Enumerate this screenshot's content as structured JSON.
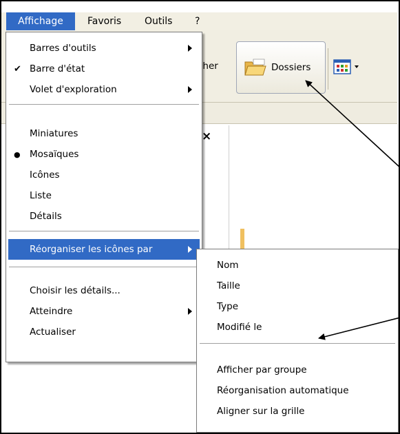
{
  "menubar": {
    "items": [
      "Affichage",
      "Favoris",
      "Outils",
      "?"
    ]
  },
  "toolbar": {
    "search_partial": "cher",
    "folders_label": "Dossiers"
  },
  "panel": {
    "close": "×"
  },
  "view_menu": {
    "items": [
      {
        "label": "Barres d'outils",
        "submenu": true
      },
      {
        "label": "Barre d'état",
        "mark": "✔"
      },
      {
        "label": "Volet d'exploration",
        "submenu": true
      },
      {
        "label": "Miniatures"
      },
      {
        "label": "Mosaïques",
        "mark": "●"
      },
      {
        "label": "Icônes"
      },
      {
        "label": "Liste"
      },
      {
        "label": "Détails"
      },
      {
        "label": "Réorganiser les icônes par",
        "submenu": true,
        "highlighted": true
      },
      {
        "label": "Choisir les détails..."
      },
      {
        "label": "Atteindre",
        "submenu": true
      },
      {
        "label": "Actualiser"
      }
    ]
  },
  "arrange_menu": {
    "items": [
      {
        "label": "Nom"
      },
      {
        "label": "Taille"
      },
      {
        "label": "Type"
      },
      {
        "label": "Modifié le"
      },
      {
        "label": "Afficher par groupe"
      },
      {
        "label": "Réorganisation automatique"
      },
      {
        "label": "Aligner sur la grille"
      }
    ]
  },
  "colors": {
    "highlight": "#316ac5",
    "menubar_bg": "#f2efe3"
  }
}
